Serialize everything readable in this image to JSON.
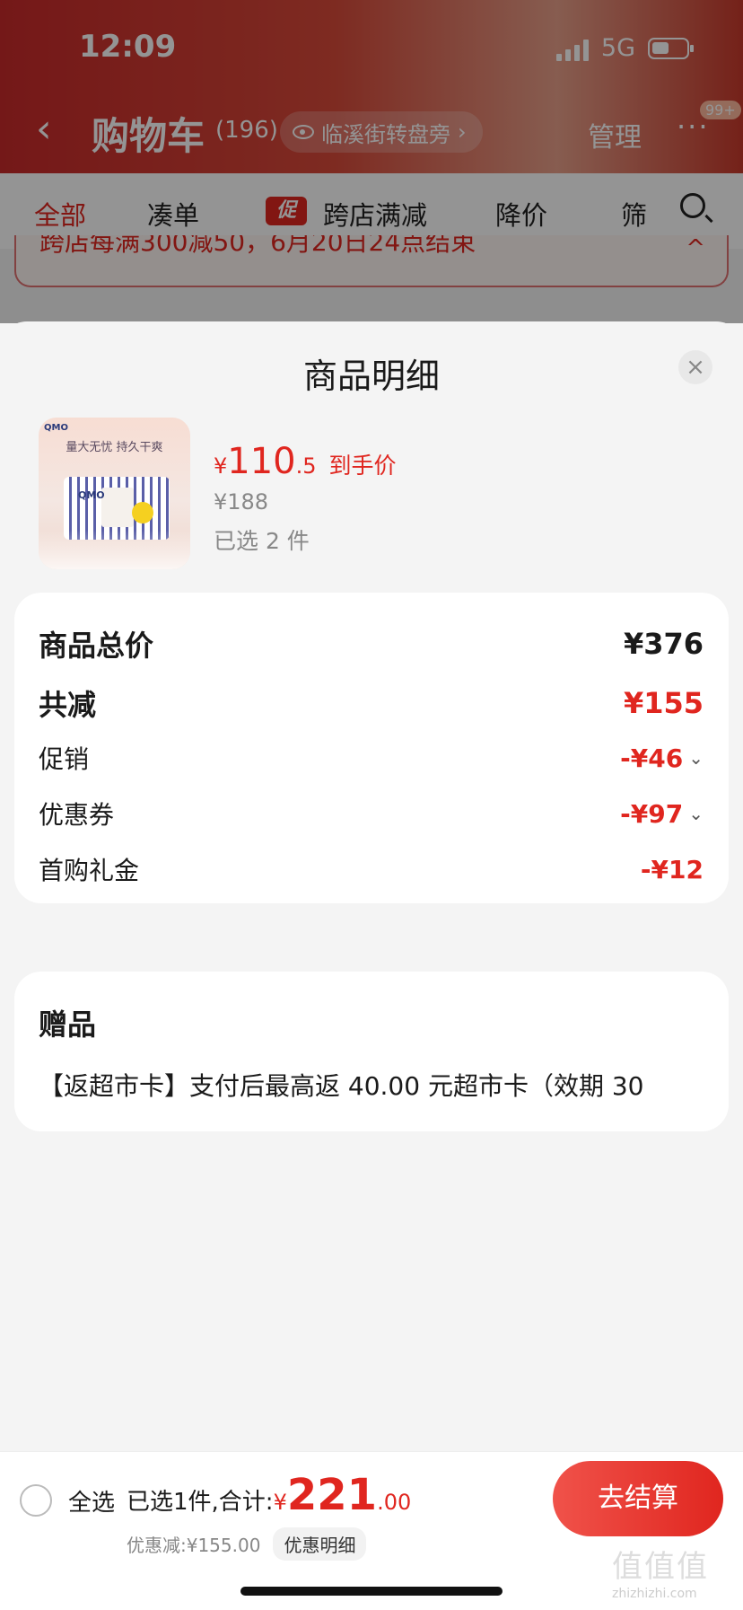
{
  "status_bar": {
    "time": "12:09",
    "network": "5G"
  },
  "nav": {
    "title": "购物车",
    "count": "(196)",
    "location": "临溪街转盘旁",
    "manage": "管理",
    "more": "···",
    "badge": "99+"
  },
  "tabs": [
    {
      "label": "全部",
      "active": true
    },
    {
      "label": "凑单"
    },
    {
      "label": "跨店满减",
      "tag": "促"
    },
    {
      "label": "降价"
    },
    {
      "label": "筛"
    }
  ],
  "banner": {
    "text": "跨店每满300减50，6月20日24点结束"
  },
  "sheet": {
    "title": "商品明细",
    "close": "×",
    "product": {
      "image_brand": "QMO",
      "image_slogan": "量大无忧 持久干爽",
      "currency": "¥",
      "price_int": "110",
      "price_dec": ".5",
      "price_note": "到手价",
      "original_price": "¥188",
      "selected": "已选 2 件"
    },
    "summary": {
      "total_label": "商品总价",
      "total_value": "¥376",
      "reduce_label": "共减",
      "reduce_value": "¥155",
      "items": [
        {
          "label": "促销",
          "value": "-¥46",
          "expandable": true
        },
        {
          "label": "优惠券",
          "value": "-¥97",
          "expandable": true
        },
        {
          "label": "首购礼金",
          "value": "-¥12",
          "expandable": false
        }
      ]
    },
    "gift": {
      "title": "赠品",
      "text": "【返超市卡】支付后最高返 40.00 元超市卡（效期 30"
    }
  },
  "bottom_bar": {
    "select_all": "全选",
    "total_label": "已选1件,合计:",
    "currency": "¥",
    "total_int": "221",
    "total_dec": ".00",
    "discount": "优惠减:¥155.00",
    "detail_button": "优惠明细",
    "checkout": "去结算"
  },
  "watermark": {
    "main": "值值值",
    "sub": "zhizhizhi.com"
  },
  "colors": {
    "accent": "#e0261f",
    "header": "#c92a2a"
  }
}
